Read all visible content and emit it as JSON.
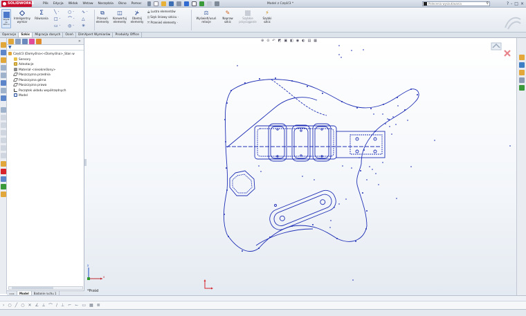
{
  "app": {
    "brand": "SOLIDWORKS",
    "document_title": "Model z Część3 *",
    "menu": [
      "Plik",
      "Edycja",
      "Widok",
      "Wstaw",
      "Narzędzia",
      "Okno",
      "Pomoc"
    ],
    "search_placeholder": "Polecenia wyszukiwania",
    "window_controls": [
      "?",
      "-",
      "□",
      "×"
    ]
  },
  "ribbon": {
    "exit_sketch": "Wyjdź ze szkicu",
    "smart_dimension": "Inteligentny wymiar",
    "equations": "Równania",
    "offset_entities": "Przesuń elementy",
    "convert_entities": "Konwertuj elementy",
    "trim_entities": "Obetnij elementy",
    "mirror_entities": "Lustro elementów",
    "linear_pattern": "Szyk liniowy szkicu",
    "move_entities": "Przenieś elementy",
    "display_relations": "Wyświetl/usuń relacje",
    "repair_sketch": "Napraw szkic",
    "quick_snaps": "Szybkie przyciąganie",
    "rapid_sketch": "Szybki szkic"
  },
  "command_tabs": [
    "Operacje",
    "Szkic",
    "Migracja danych",
    "Oceń",
    "DimXpert Wymiarów",
    "Produkty Office"
  ],
  "active_tab_index": 1,
  "tree": [
    {
      "label": "Część3  (Domyślna<<Domyślna>_Stan w",
      "icon": "part-icon"
    },
    {
      "label": "Sensory",
      "icon": "sensor-icon"
    },
    {
      "label": "Adnotacje",
      "icon": "annotation-icon"
    },
    {
      "label": "Materiał <nieokreślony>",
      "icon": "material-icon"
    },
    {
      "label": "Płaszczyzna przednia",
      "icon": "plane-icon"
    },
    {
      "label": "Płaszczyzna górna",
      "icon": "plane-icon"
    },
    {
      "label": "Płaszczyzna prawa",
      "icon": "plane-icon"
    },
    {
      "label": "Początek układu współrzędnych",
      "icon": "origin-icon"
    },
    {
      "label": "Model",
      "icon": "sketch-icon"
    }
  ],
  "model_tabs": [
    "Model",
    "Badanie ruchu 1"
  ],
  "view": {
    "orientation_label": "*Przód",
    "triad_x": "x",
    "triad_y": "y"
  },
  "colors": {
    "sketch": "#1f2fb5",
    "brand_red": "#c8102e",
    "origin_red": "#d8232a",
    "ribbon_bg": "#e9edf2"
  }
}
